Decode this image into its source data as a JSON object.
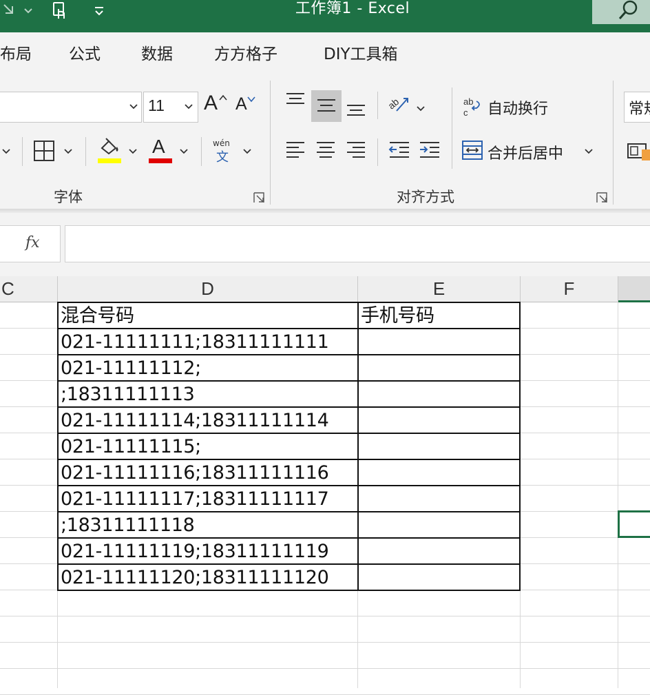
{
  "titlebar": {
    "title": "工作簿1  -  Excel",
    "icons": [
      "redo-icon",
      "dropdown-arrow-icon",
      "touch-mode-icon",
      "customize-qat-icon",
      "search-icon"
    ]
  },
  "tabs": [
    "布局",
    "公式",
    "数据",
    "方方格子",
    "DIY工具箱"
  ],
  "ribbon": {
    "font_group": {
      "font_size": "11",
      "grow_font": "A",
      "shrink_font": "A",
      "font_color_letter": "A",
      "phonetic_top": "wén",
      "phonetic_bottom": "文",
      "label": "字体",
      "highlight_color": "#ffff00",
      "font_color": "#e00000"
    },
    "align_group": {
      "wrap_text": "自动换行",
      "merge_center": "合并后居中",
      "label": "对齐方式"
    },
    "number_group": {
      "format_partial": "常规"
    }
  },
  "formula_bar": {
    "fx_label": "fx",
    "value": ""
  },
  "sheet": {
    "columns": [
      "C",
      "D",
      "E",
      "F"
    ],
    "header_row": {
      "D": "混合号码",
      "E": "手机号码"
    },
    "rows": [
      "021-11111111;18311111111",
      "021-11111112;",
      ";18311111113",
      "021-11111114;18311111114",
      "021-11111115;",
      "021-11111116;18311111116",
      "021-11111117;18311111117",
      ";18311111118",
      "021-11111119;18311111119",
      "021-11111120;18311111120"
    ],
    "selection_color": "#1e7145"
  }
}
